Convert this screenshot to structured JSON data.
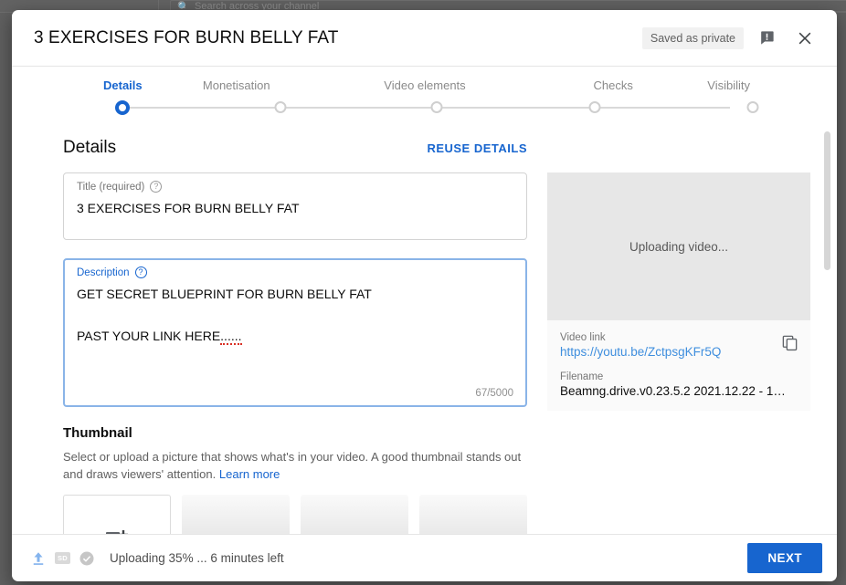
{
  "background": {
    "search_placeholder": "Search across your channel",
    "search_icon": "search-icon"
  },
  "header": {
    "title": "3 EXERCISES FOR BURN BELLY FAT",
    "saved_badge": "Saved as private",
    "feedback_icon": "feedback-icon",
    "close_icon": "close-icon"
  },
  "stepper": {
    "steps": [
      {
        "label": "Details",
        "active": true
      },
      {
        "label": "Monetisation",
        "active": false
      },
      {
        "label": "Video elements",
        "active": false
      },
      {
        "label": "Checks",
        "active": false
      },
      {
        "label": "Visibility",
        "active": false
      }
    ]
  },
  "details": {
    "section_title": "Details",
    "reuse_label": "REUSE DETAILS",
    "title_field": {
      "label": "Title (required)",
      "value": "3 EXERCISES FOR BURN BELLY FAT",
      "help_icon": "help-circle-icon"
    },
    "description_field": {
      "label": "Description",
      "help_icon": "help-circle-icon",
      "line1": "GET SECRET BLUEPRINT FOR BURN BELLY FAT",
      "line2_text": "PAST YOUR LINK HERE",
      "line2_suffix": "......",
      "char_count": "67/5000"
    }
  },
  "thumbnail": {
    "title": "Thumbnail",
    "description": "Select or upload a picture that shows what's in your video. A good thumbnail stands out and draws viewers' attention.",
    "learn_more": "Learn more",
    "upload_icon": "image-add-icon",
    "tiles": [
      "upload",
      "placeholder",
      "placeholder",
      "placeholder"
    ]
  },
  "preview": {
    "status": "Uploading video...",
    "video_link_label": "Video link",
    "video_link": "https://youtu.be/ZctpsgKFr5Q",
    "copy_icon": "copy-icon",
    "filename_label": "Filename",
    "filename": "Beamng.drive.v0.23.5.2 2021.12.22 - 12…"
  },
  "footer": {
    "upload_icon": "upload-arrow-icon",
    "quality_badge": "SD",
    "checks_icon": "check-circle-icon",
    "status": "Uploading 35% ... 6 minutes left",
    "next_label": "NEXT"
  },
  "colors": {
    "accent": "#1765cf",
    "link": "#3e8ede",
    "muted": "#767676",
    "spellcheck": "#d93025"
  }
}
